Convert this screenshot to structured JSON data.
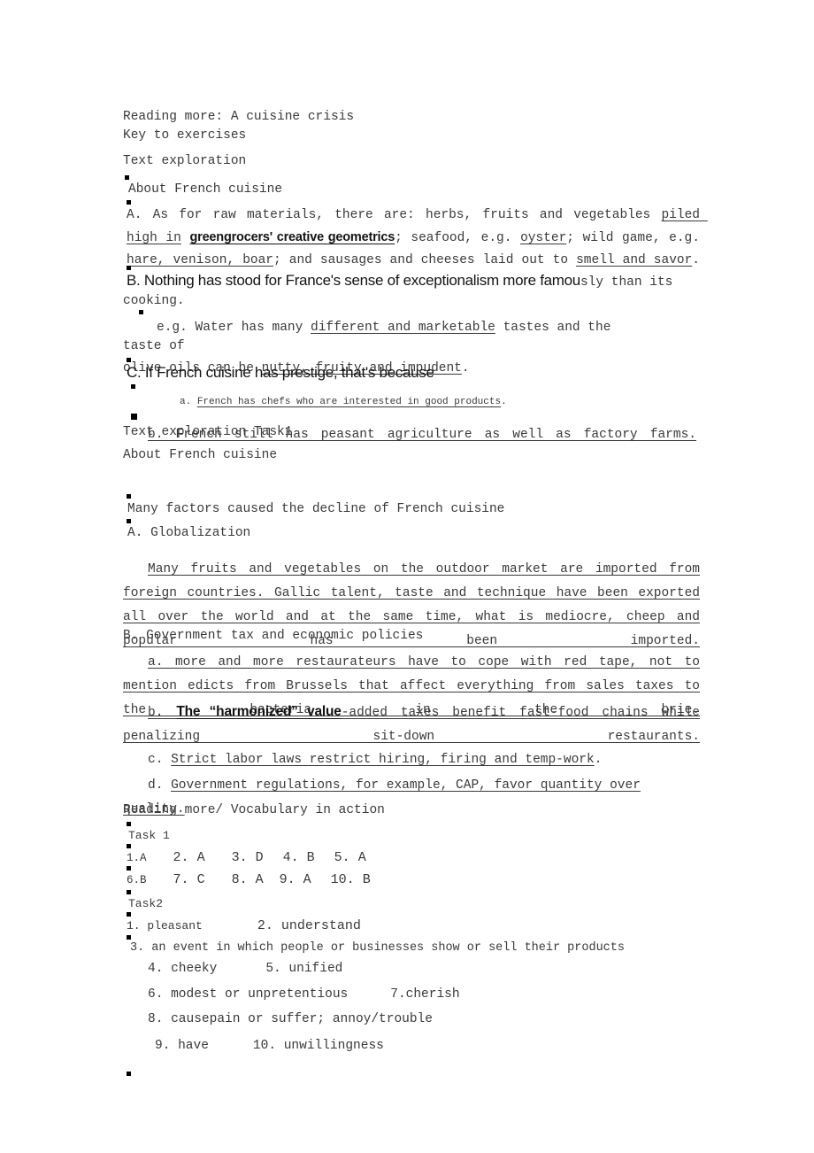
{
  "document": {
    "title_line_1": "Reading more: A cuisine crisis",
    "title_line_2": "Key to exercises",
    "section_1_heading": "Text exploration",
    "section_1_sub": "About French cuisine",
    "item_A": {
      "prefix": "A. As for raw materials, there are: herbs, fruits and vegetables ",
      "u1": "piled high in",
      "u2": "greengrocers' creative geometrics",
      "mid1": "; seafood, e.g. ",
      "u3": "oyster",
      "mid2": "; wild game, e.g. ",
      "u4": "hare, venison, boar",
      "mid3": "; and sausages and cheeses laid out to ",
      "u5": "smell and savor",
      "end": "."
    },
    "item_B": {
      "sans_part": "B. Nothing has stood for France's sense of exceptionalism more famou",
      "serif_part": "sly than its",
      "second_line": "cooking."
    },
    "item_B_eg": {
      "prefix": "e.g. Water has many ",
      "u1": "different and marketable",
      "mid": " tastes and the",
      "tail": "taste of",
      "line2_prefix": "olive oils can be ",
      "line2_u": "nutty, fruity and impudent",
      "line2_end": "."
    },
    "item_C": "C. If French cuisine has prestige, that's because",
    "item_C_a": {
      "label": "a. ",
      "text": "French has chefs who are interested in good products",
      "end": "."
    },
    "item_C_b": {
      "label": "b. ",
      "text": "French still has peasant agriculture as well as factory farms."
    },
    "section_2_heading": "Text exploration Task1",
    "section_2_sub": "About French cuisine",
    "factors_heading": "Many factors caused the decline of French cuisine",
    "item_A2": "A. Globalization",
    "item_A2_body": "Many fruits and vegetables on the outdoor market are imported from foreign countries. Gallic talent, taste and technique have been exported all over the world and at the same time, what is mediocre, cheep and popular has been imported.",
    "item_B2": "B. Government tax and economic policies",
    "item_B2_a": {
      "label": "a. ",
      "text": "more and more restaurateurs have to cope with red tape, not to mention edicts from Brussels that affect everything from sales taxes to the bacteria in the brie."
    },
    "item_B2_b": {
      "label": "b. ",
      "bold_text": "The “harmonized” value",
      "rest": "-added taxes benefit fast-food chains while penalizing sit-down restaurants."
    },
    "item_B2_c": {
      "label": "c. ",
      "text": "Strict labor laws restrict hiring, firing and temp-work",
      "end": "."
    },
    "item_B2_d": {
      "label": "d. ",
      "text": "Government regulations, for example, CAP, favor quantity over quality."
    },
    "section_3_heading": "Reading more/ Vocabulary in action",
    "task1_label": "Task 1",
    "task1_answers_row1": [
      {
        "num": "1.",
        "ans": "A"
      },
      {
        "num": "2.",
        "ans": "A"
      },
      {
        "num": "3.",
        "ans": "D"
      },
      {
        "num": "4.",
        "ans": "B"
      },
      {
        "num": "5.",
        "ans": "A"
      }
    ],
    "task1_answers_row2": [
      {
        "num": "6.",
        "ans": "B"
      },
      {
        "num": "7.",
        "ans": "C"
      },
      {
        "num": "8.",
        "ans": "A"
      },
      {
        "num": "9.",
        "ans": "A"
      },
      {
        "num": "10.",
        "ans": "B"
      }
    ],
    "task2_label": "Task2",
    "task2_line1_a": "1. pleasant",
    "task2_line1_b": "2. understand",
    "task2_line2": "3. an event in which people or businesses show or sell their products",
    "task2_line3_a": "4. cheeky",
    "task2_line3_b": "5. unified",
    "task2_line4_a": "6. modest or unpretentious",
    "task2_line4_b": "7.cherish",
    "task2_line5": "8. causepain or suffer; annoy/trouble",
    "task2_line6_a": "9. have",
    "task2_line6_b": "10. unwillingness"
  }
}
